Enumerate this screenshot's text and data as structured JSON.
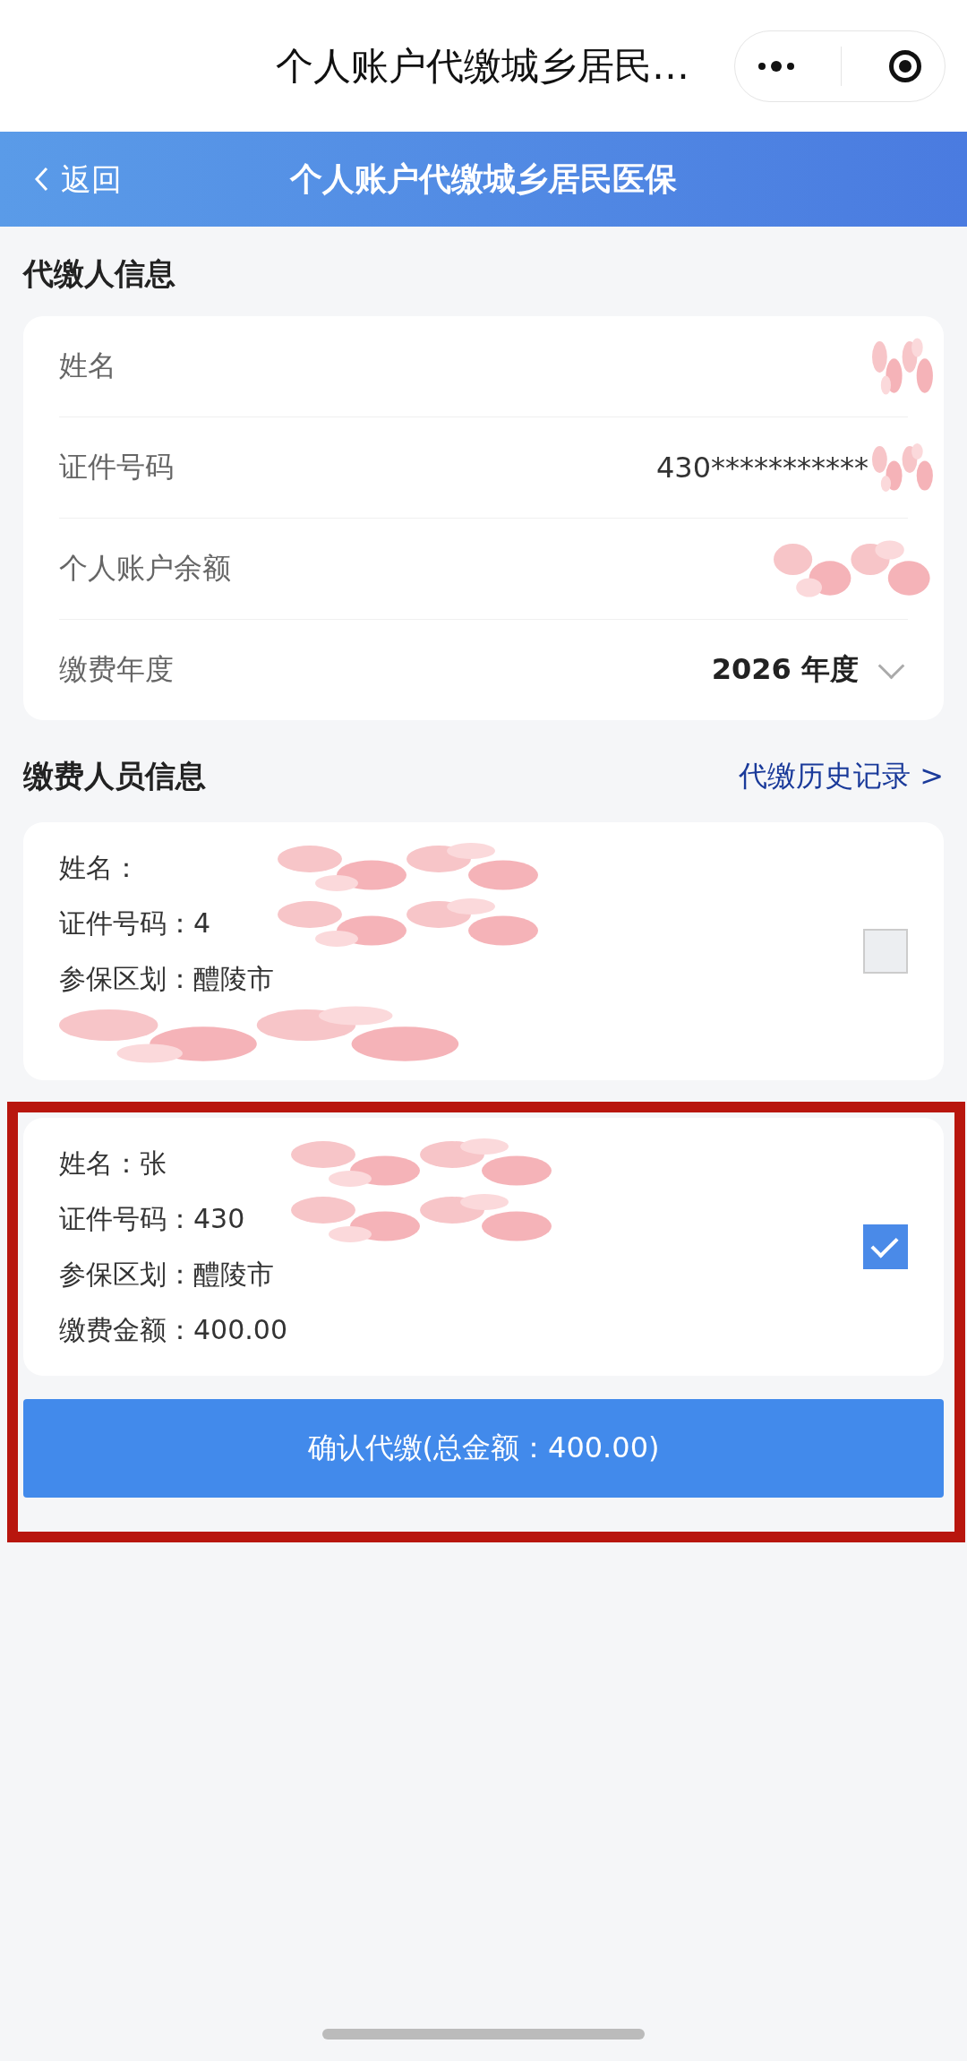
{
  "mini_program_bar": {
    "title": "个人账户代缴城乡居民…"
  },
  "nav_bar": {
    "back": "返回",
    "title": "个人账户代缴城乡居民医保"
  },
  "payer_section": {
    "title": "代缴人信息",
    "rows": [
      {
        "label": "姓名",
        "redacted": true
      },
      {
        "label": "证件号码",
        "value": "430***********",
        "redacted": true
      },
      {
        "label": "个人账户余额",
        "redacted": true
      },
      {
        "label": "缴费年度",
        "value": "2026 年度",
        "kind": "dropdown",
        "redacted": false
      }
    ]
  },
  "payee_section": {
    "title": "缴费人员信息",
    "link": "代缴历史记录 >",
    "persons": [
      {
        "checked": false,
        "highlighted": false,
        "lines": [
          {
            "text": "姓名：",
            "redacted": true
          },
          {
            "text": "证件号码：4",
            "redacted": true
          },
          {
            "text": "参保区划：醴陵市",
            "redacted": false
          },
          {
            "redacted": true
          }
        ]
      },
      {
        "checked": true,
        "highlighted": true,
        "lines": [
          {
            "text": "姓名：张",
            "redacted": true
          },
          {
            "text": "证件号码：430",
            "redacted": true
          },
          {
            "text": "参保区划：醴陵市",
            "redacted": false
          },
          {
            "text": "缴费金额：400.00",
            "redacted": false
          }
        ]
      }
    ]
  },
  "confirm_button": {
    "label": "确认代缴(总金额：400.00)"
  }
}
